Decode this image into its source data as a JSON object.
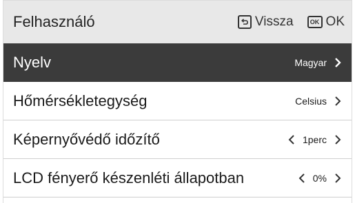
{
  "header": {
    "title": "Felhasználó",
    "back_label": "Vissza",
    "ok_label": "OK",
    "ok_icon_text": "OK"
  },
  "menu": {
    "items": [
      {
        "label": "Nyelv",
        "value": "Magyar",
        "selected": true
      },
      {
        "label": "Hőmérsékletegység",
        "value": "Celsius",
        "selected": false
      },
      {
        "label": "Képernyővédő időzítő",
        "value": "1perc",
        "selected": false
      },
      {
        "label": "LCD fényerő készenléti állapotban",
        "value": "0%",
        "selected": false
      }
    ]
  },
  "colors": {
    "header_bg": "#e8e8e8",
    "selected_bg": "#3b3b3b",
    "selected_text": "#ffffff",
    "text": "#1a1a1a"
  },
  "icons": {
    "back": "return-arrow-icon",
    "ok": "ok-key-icon",
    "next": "chevron-right-icon",
    "prev": "chevron-left-icon"
  }
}
